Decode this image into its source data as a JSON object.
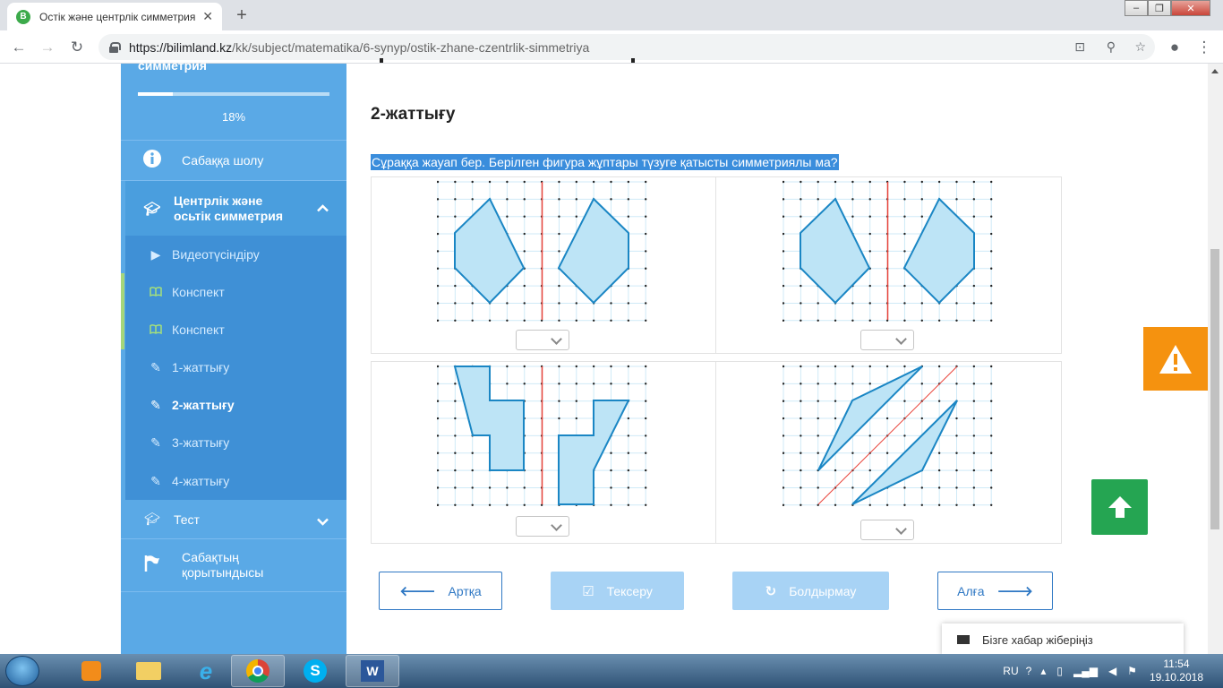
{
  "browser": {
    "tab_title": "Остік және центрлік симметрия",
    "url_host": "https://bilimland.kz",
    "url_path": "/kk/subject/matematika/6-synyp/ostik-zhane-czentrlik-simmetriya"
  },
  "sidebar": {
    "course_title": "симметрия",
    "progress": 0.18,
    "progress_label": "18%",
    "overview": "Сабаққа шолу",
    "section_line1": "Центрлік және",
    "section_line2": "осьтік симметрия",
    "items": [
      {
        "label": "Видеотүсіндіру",
        "icon": "play-icon"
      },
      {
        "label": "Конспект",
        "icon": "book-icon"
      },
      {
        "label": "Конспект",
        "icon": "book-icon"
      },
      {
        "label": "1-жаттығу",
        "icon": "edit-icon"
      },
      {
        "label": "2-жаттығу",
        "icon": "edit-icon"
      },
      {
        "label": "3-жаттығу",
        "icon": "edit-icon"
      },
      {
        "label": "4-жаттығу",
        "icon": "edit-icon"
      }
    ],
    "test": "Тест",
    "summary_line1": "Сабақтың",
    "summary_line2": "қорытындысы"
  },
  "main": {
    "exercise_title": "2-жаттығу",
    "question": "Сұраққа жауап бер. Берілген фигура жұптары түзуге қатысты симметриялы ма?",
    "answers": [
      "",
      "",
      "",
      ""
    ]
  },
  "buttons": {
    "back": "Артқа",
    "check": "Тексеру",
    "cancel": "Болдырмау",
    "next": "Алға"
  },
  "feedback": "Бізге хабар жіберіңіз",
  "taskbar": {
    "lang": "RU",
    "time": "11:54",
    "date": "19.10.2018"
  },
  "colors": {
    "accent": "#3a8ddc",
    "sidebar": "#5aa9e6",
    "shape_fill": "#bde4f6",
    "shape_stroke": "#1a86c4",
    "axis": "#e8433a",
    "warning": "#f5920f",
    "up": "#25a552"
  }
}
